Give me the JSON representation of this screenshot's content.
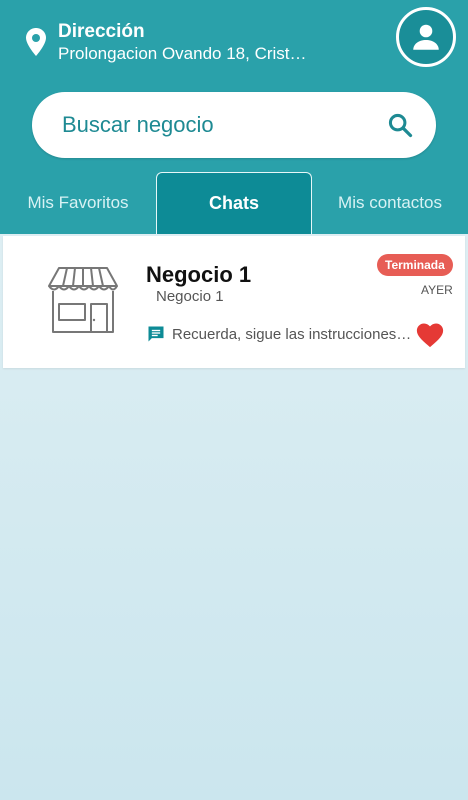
{
  "header": {
    "address_title": "Dirección",
    "address_line": "Prolongacion Ovando 18, Crist…"
  },
  "search": {
    "placeholder": "Buscar negocio"
  },
  "tabs": [
    {
      "label": "Mis Favoritos",
      "active": false
    },
    {
      "label": "Chats",
      "active": true
    },
    {
      "label": "Mis contactos",
      "active": false
    }
  ],
  "chats": [
    {
      "name": "Negocio 1",
      "subtitle": "Negocio 1",
      "status": "Terminada",
      "time": "AYER",
      "last_message": "Recuerda, sigue las instrucciones…",
      "favorite": true
    }
  ],
  "colors": {
    "primary": "#2aa1aa",
    "tab_active": "#0d8b96",
    "badge": "#e75d55",
    "heart": "#e53935"
  },
  "icons": [
    "location-pin-icon",
    "account-icon",
    "search-icon",
    "store-icon",
    "message-icon",
    "heart-icon"
  ]
}
